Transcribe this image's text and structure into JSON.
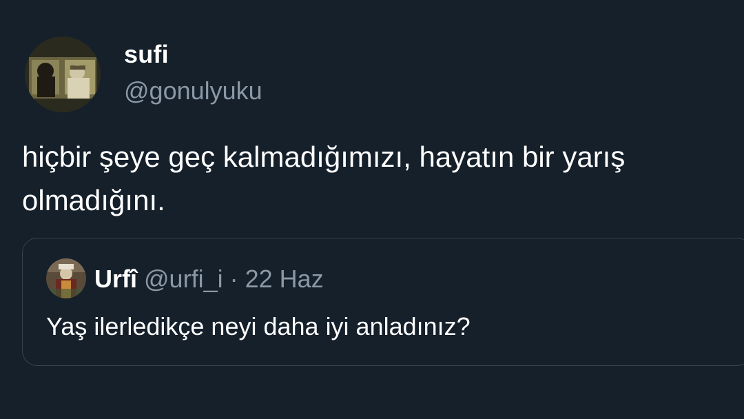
{
  "tweet": {
    "author": {
      "display_name": "sufi",
      "handle": "@gonulyuku",
      "avatar_icon": "profile-photo"
    },
    "text": "hiçbir şeye geç kalmadığımızı, hayatın bir yarış olmadığını."
  },
  "quoted_tweet": {
    "author": {
      "display_name": "Urfî",
      "handle": "@urfi_i",
      "avatar_icon": "profile-photo"
    },
    "separator": "·",
    "date": "22 Haz",
    "text": "Yaş ilerledikçe neyi daha iyi anladınız?"
  },
  "colors": {
    "background": "#15202b",
    "primary_text": "#ffffff",
    "secondary_text": "#8b98a5",
    "border": "#38444d"
  }
}
